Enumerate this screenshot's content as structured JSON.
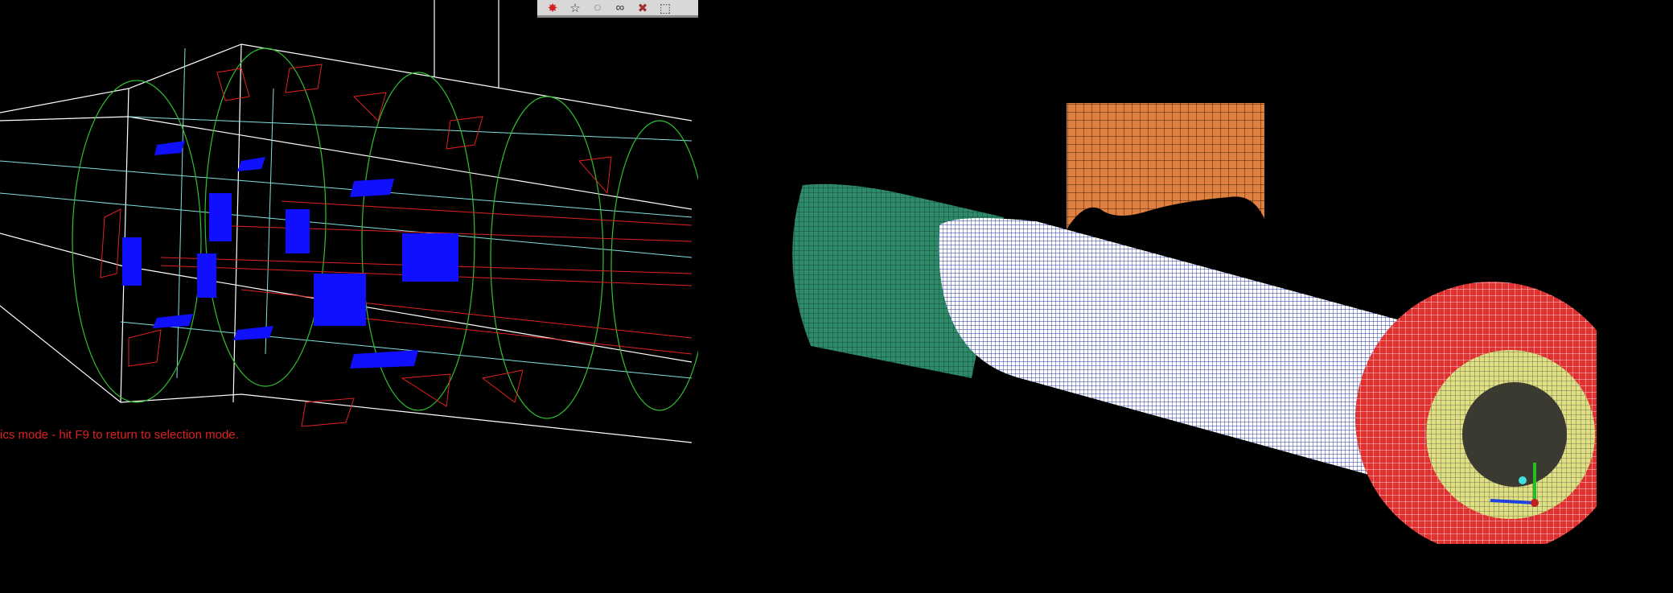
{
  "left_viewport": {
    "status_message": "ics mode - hit F9 to return to selection mode.",
    "toolbar": [
      {
        "icon": "select-burst-icon",
        "glyph": "✸",
        "color": "#d02020"
      },
      {
        "icon": "lasso-star-icon",
        "glyph": "☆",
        "color": "#333333"
      },
      {
        "icon": "lasso-circle-icon",
        "glyph": "◌",
        "color": "#333333"
      },
      {
        "icon": "lasso-loop-icon",
        "glyph": "∞",
        "color": "#333333"
      },
      {
        "icon": "deselect-icon",
        "glyph": "✖",
        "color": "#a03030"
      },
      {
        "icon": "box-select-icon",
        "glyph": "⬚",
        "color": "#333333"
      }
    ]
  },
  "colors": {
    "wire_white": "#ffffff",
    "wire_red": "#e02020",
    "wire_green": "#30c030",
    "wire_cyan": "#80e0e0",
    "face_blue": "#1010ff",
    "mesh_green": "#2f8a6a",
    "mesh_blue": "#2030a0",
    "mesh_red": "#e03030",
    "mesh_orange": "#e08040",
    "mesh_yellow": "#e0e080"
  }
}
